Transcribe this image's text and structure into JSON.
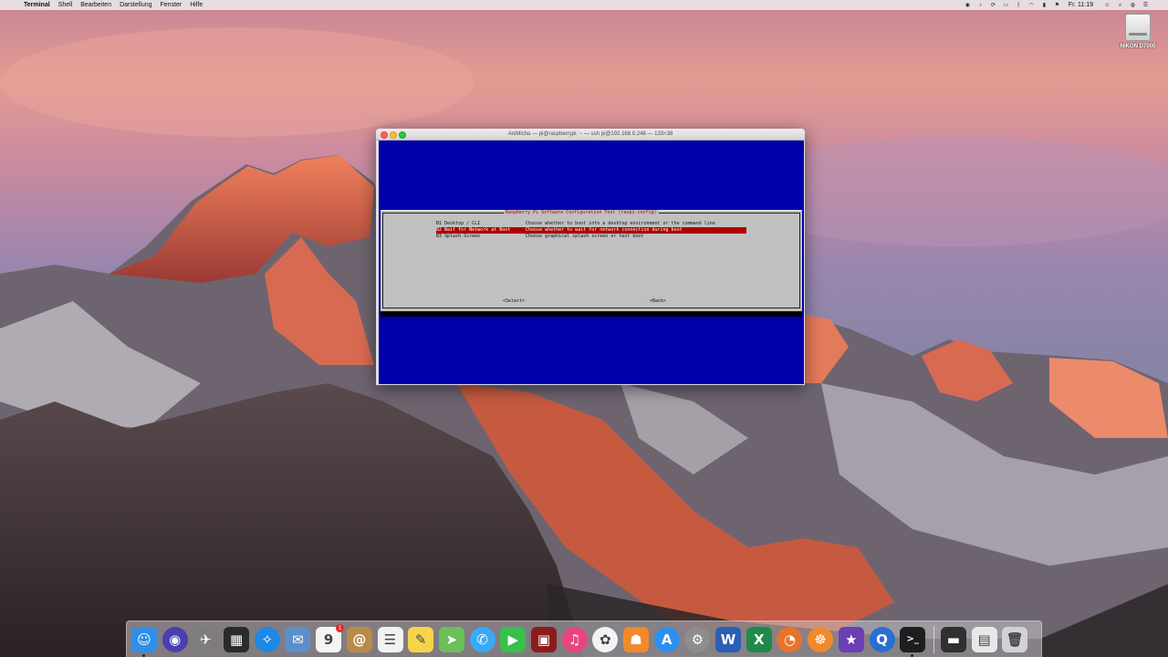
{
  "menubar": {
    "apple_glyph": "",
    "items": [
      "Terminal",
      "Shell",
      "Bearbeiten",
      "Darstellung",
      "Fenster",
      "Hilfe"
    ],
    "clock": "Fr. 11:19",
    "status_icons": [
      "record-icon",
      "volume-icon",
      "sync-icon",
      "airplay-icon",
      "bluetooth-icon",
      "wifi-icon",
      "battery-icon",
      "flag-icon",
      "user-icon",
      "spotlight-icon",
      "siri-icon",
      "notification-icon"
    ]
  },
  "desktop": {
    "drive_label": "NIKON D7000"
  },
  "terminal": {
    "window_title": "AniMicha — pi@raspberrypi: ~ — ssh pi@192.168.0.248 — 133×38",
    "dialog_title": "Raspberry Pi Software Configuration Tool (raspi-config)",
    "options": [
      {
        "name": "B1 Desktop / CLI",
        "desc": "Choose whether to boot into a desktop environment or the command line",
        "selected": false
      },
      {
        "name": "B2 Wait for Network at Boot",
        "desc": "Choose whether to wait for network connection during boot",
        "selected": true
      },
      {
        "name": "B3 Splash Screen",
        "desc": "Choose graphical splash screen or text boot",
        "selected": false
      }
    ],
    "select_label": "<Select>",
    "back_label": "<Back>",
    "colors": {
      "background": "#0000aa",
      "dialog": "#c0c0c0",
      "highlight": "#b00000"
    }
  },
  "dock": {
    "items": [
      {
        "name": "finder",
        "glyph": "☺",
        "color": "#2f8ee8",
        "running": true
      },
      {
        "name": "siri",
        "glyph": "◉",
        "color": "#4a3fb0",
        "round": true
      },
      {
        "name": "launchpad",
        "glyph": "✈",
        "color": "#7d7d7d",
        "round": true
      },
      {
        "name": "mission-control",
        "glyph": "▦",
        "color": "#2b2b2b"
      },
      {
        "name": "safari",
        "glyph": "✧",
        "color": "#1e88e5",
        "round": true
      },
      {
        "name": "mail",
        "glyph": "✉",
        "color": "#5b8fc9"
      },
      {
        "name": "calendar",
        "glyph": "9",
        "color": "#f4f4f4",
        "badge": "1"
      },
      {
        "name": "contacts",
        "glyph": "@",
        "color": "#b88a4b"
      },
      {
        "name": "reminders",
        "glyph": "☰",
        "color": "#f2f2f2"
      },
      {
        "name": "notes",
        "glyph": "✎",
        "color": "#f6d44a"
      },
      {
        "name": "maps",
        "glyph": "➤",
        "color": "#6cbf5a"
      },
      {
        "name": "messages",
        "glyph": "✆",
        "color": "#3aa9f5",
        "round": true
      },
      {
        "name": "facetime",
        "glyph": "▶",
        "color": "#37c04a"
      },
      {
        "name": "photo-booth",
        "glyph": "▣",
        "color": "#8c1c1c"
      },
      {
        "name": "itunes",
        "glyph": "♫",
        "color": "#e8457e",
        "round": true
      },
      {
        "name": "photos",
        "glyph": "✿",
        "color": "#f3f3f3",
        "round": true
      },
      {
        "name": "ibooks",
        "glyph": "☗",
        "color": "#f08a2c"
      },
      {
        "name": "app-store",
        "glyph": "A",
        "color": "#2d8ff0",
        "round": true
      },
      {
        "name": "system-preferences",
        "glyph": "⚙",
        "color": "#8d8d8d",
        "round": true
      },
      {
        "name": "word",
        "glyph": "W",
        "color": "#2b5fb4"
      },
      {
        "name": "excel",
        "glyph": "X",
        "color": "#1f8a4c"
      },
      {
        "name": "firefox",
        "glyph": "◔",
        "color": "#e8742b",
        "round": true
      },
      {
        "name": "vpn",
        "glyph": "☸",
        "color": "#f08a2c",
        "round": true
      },
      {
        "name": "imovie",
        "glyph": "★",
        "color": "#6a3fb4"
      },
      {
        "name": "quicktime",
        "glyph": "Q",
        "color": "#2a6fd0",
        "round": true
      },
      {
        "name": "terminal",
        "glyph": ">_",
        "color": "#1e1e1e",
        "running": true
      },
      {
        "name": "minimized-window",
        "glyph": "▬",
        "color": "#303030",
        "separator_before": true
      },
      {
        "name": "document-preview",
        "glyph": "▤",
        "color": "#e8e8e8"
      },
      {
        "name": "trash",
        "glyph": "🗑",
        "color": "#cfd2d6"
      }
    ]
  }
}
